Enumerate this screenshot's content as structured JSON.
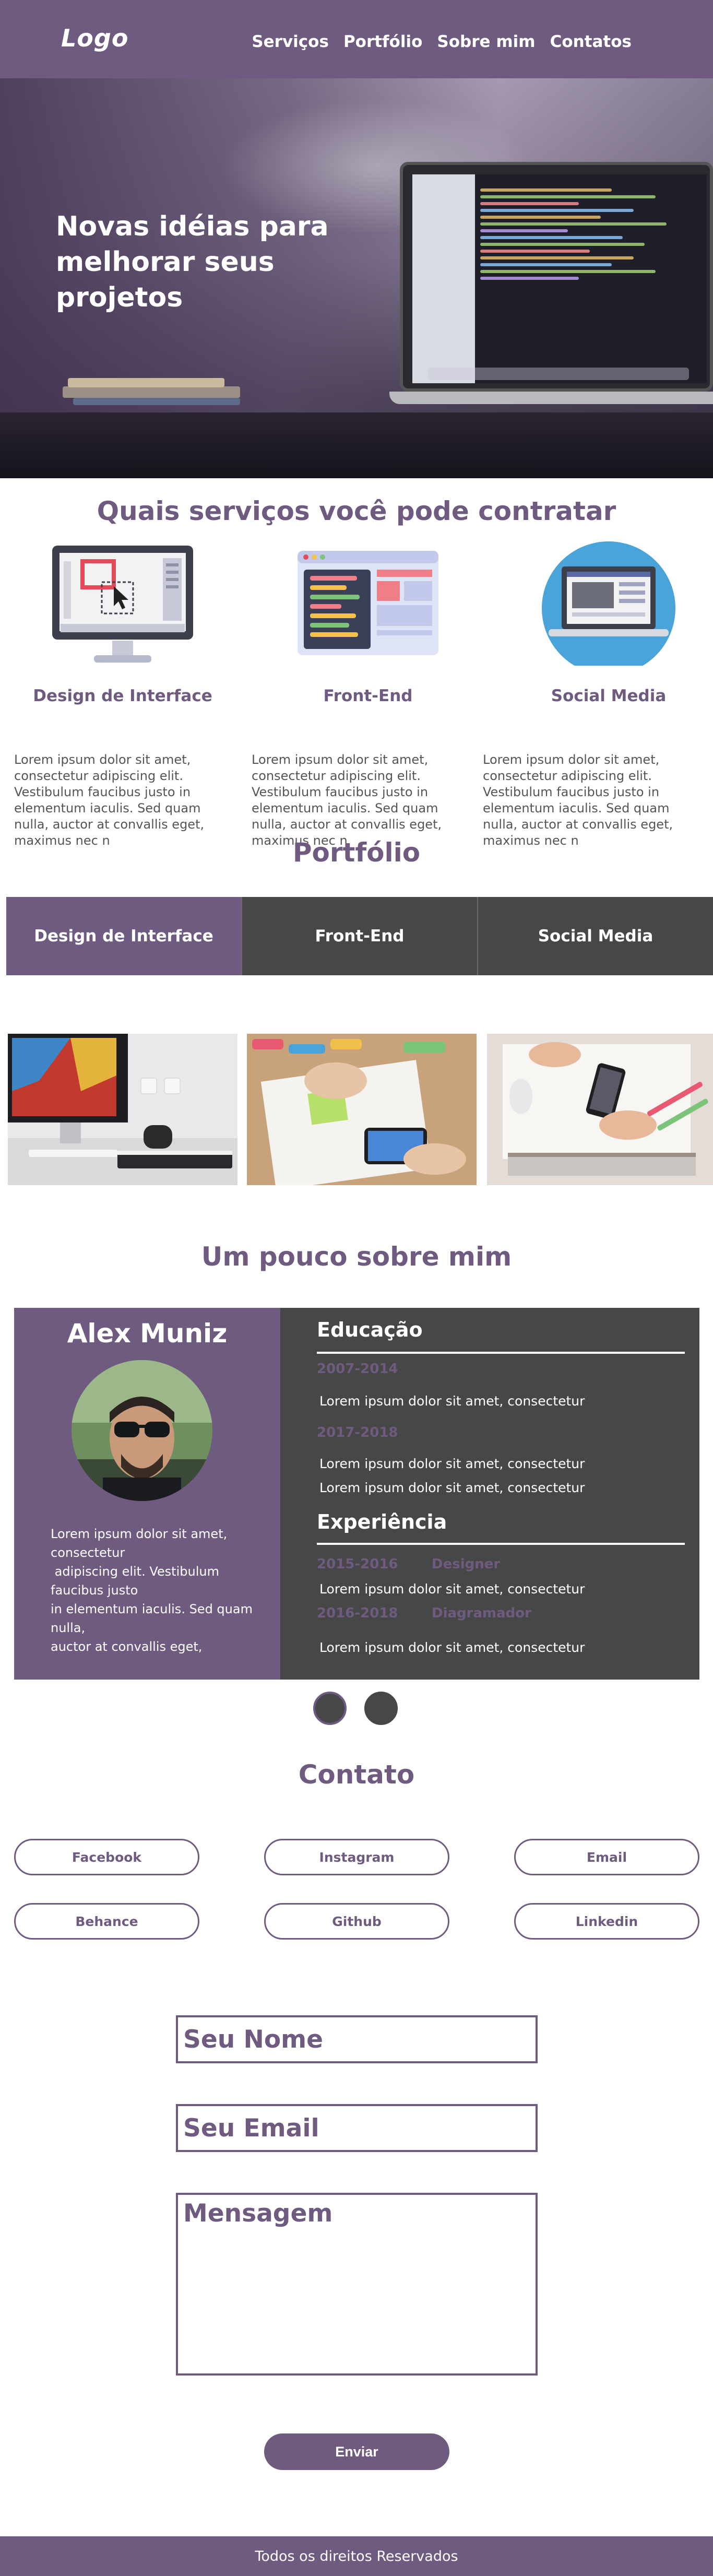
{
  "header": {
    "logo": "Logo",
    "nav": [
      "Serviços",
      "Portfólio",
      "Sobre mim",
      "Contatos"
    ]
  },
  "hero": {
    "title_line1": "Novas idéias para",
    "title_line2": "melhorar seus projetos"
  },
  "services": {
    "title": "Quais serviços você pode contratar",
    "items": [
      {
        "title": "Design de Interface",
        "icon": "monitor-design-icon",
        "text": "Lorem ipsum dolor sit amet, consectetur adipiscing elit. Vestibulum faucibus justo in elementum iaculis. Sed quam nulla, auctor at convallis eget, maximus nec n"
      },
      {
        "title": "Front-End",
        "icon": "browser-code-icon",
        "text": "Lorem ipsum dolor sit amet, consectetur adipiscing elit. Vestibulum faucibus justo in elementum iaculis. Sed quam nulla, auctor at convallis eget, maximus nec n"
      },
      {
        "title": "Social Media",
        "icon": "laptop-social-icon",
        "text": "Lorem ipsum dolor sit amet, consectetur adipiscing elit. Vestibulum faucibus justo in elementum iaculis. Sed quam nulla, auctor at convallis eget, maximus nec n"
      }
    ]
  },
  "portfolio": {
    "title": "Portfólio",
    "tabs": [
      "Design de Interface",
      "Front-End",
      "Social Media"
    ],
    "active_tab": "Design de Interface"
  },
  "about": {
    "title": "Um pouco sobre mim",
    "name": "Alex Muniz",
    "bio_lines": [
      "Lorem ipsum dolor sit amet,",
      "consectetur",
      " adipiscing elit. Vestibulum",
      "faucibus justo",
      "in elementum iaculis. Sed quam",
      "nulla,",
      "auctor at convallis eget,"
    ],
    "education_heading": "Educação",
    "education": [
      {
        "year": "2007-2014",
        "lines": [
          "Lorem ipsum dolor sit amet, consectetur"
        ]
      },
      {
        "year": "2017-2018",
        "lines": [
          "Lorem ipsum dolor sit amet, consectetur",
          "Lorem ipsum dolor sit amet, consectetur"
        ]
      }
    ],
    "experience_heading": "Experiência",
    "experience": [
      {
        "year": "2015-2016",
        "role": "Designer",
        "text": "Lorem ipsum dolor sit amet, consectetur"
      },
      {
        "year": "2016-2018",
        "role": "Diagramador",
        "text": "Lorem ipsum dolor sit amet, consectetur"
      }
    ]
  },
  "contact": {
    "title": "Contato",
    "buttons": [
      "Facebook",
      "Instagram",
      "Email",
      "Behance",
      "Github",
      "Linkedin"
    ],
    "name_placeholder": "Seu Nome",
    "email_placeholder": "Seu Email",
    "message_placeholder": "Mensagem",
    "send_label": "Enviar"
  },
  "footer": {
    "text": "Todos os direitos Reservados"
  },
  "colors": {
    "brand": "#6f5b80",
    "dark": "#474747"
  }
}
